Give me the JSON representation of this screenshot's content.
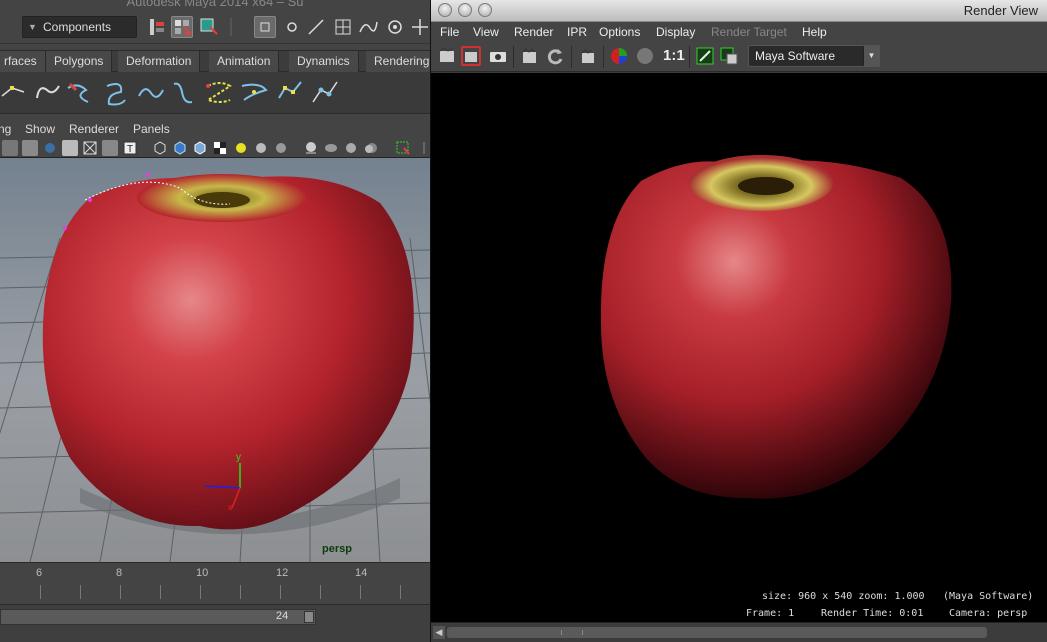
{
  "maya": {
    "title": "Autodesk Maya 2014 x64 – Su",
    "mode_selector": "Components",
    "shelf_tabs": [
      "rfaces",
      "Polygons",
      "Deformation",
      "Animation",
      "Dynamics",
      "Rendering"
    ],
    "panel_menu": [
      "ng",
      "Show",
      "Renderer",
      "Panels"
    ],
    "camera": "persp",
    "time_ticks": [
      "6",
      "8",
      "10",
      "12",
      "14"
    ],
    "range_end": "24"
  },
  "render_view": {
    "title": "Render View",
    "menu": [
      "File",
      "View",
      "Render",
      "IPR",
      "Options",
      "Display",
      "Render Target",
      "Help"
    ],
    "disabled_menu": "Render Target",
    "one_to_one": "1:1",
    "renderer": "Maya Software",
    "info": {
      "size_zoom": "size: 960 x 540 zoom: 1.000",
      "renderer": "(Maya Software)",
      "frame": "Frame: 1",
      "render_time": "Render Time: 0:01",
      "camera": "Camera: persp"
    }
  },
  "colors": {
    "apple_red": "#b3232c",
    "apple_highlight": "#e6878a",
    "stem_yellow": "#c8b84a",
    "viewport_bg": "#8a939c",
    "render_bg": "#000000"
  },
  "icons": {
    "status_line": [
      "hierarchy-icon",
      "select-by-object-icon",
      "select-by-component-icon",
      "snap-grid-icon",
      "snap-curve-icon",
      "snap-point-icon"
    ],
    "render_toolbar": [
      "redo-render-icon",
      "render-region-icon",
      "snapshot-icon",
      "ipr-icon",
      "refresh-ipr-icon",
      "rgb-channels-icon",
      "alpha-channel-icon",
      "keep-image-icon",
      "remove-image-icon"
    ]
  }
}
